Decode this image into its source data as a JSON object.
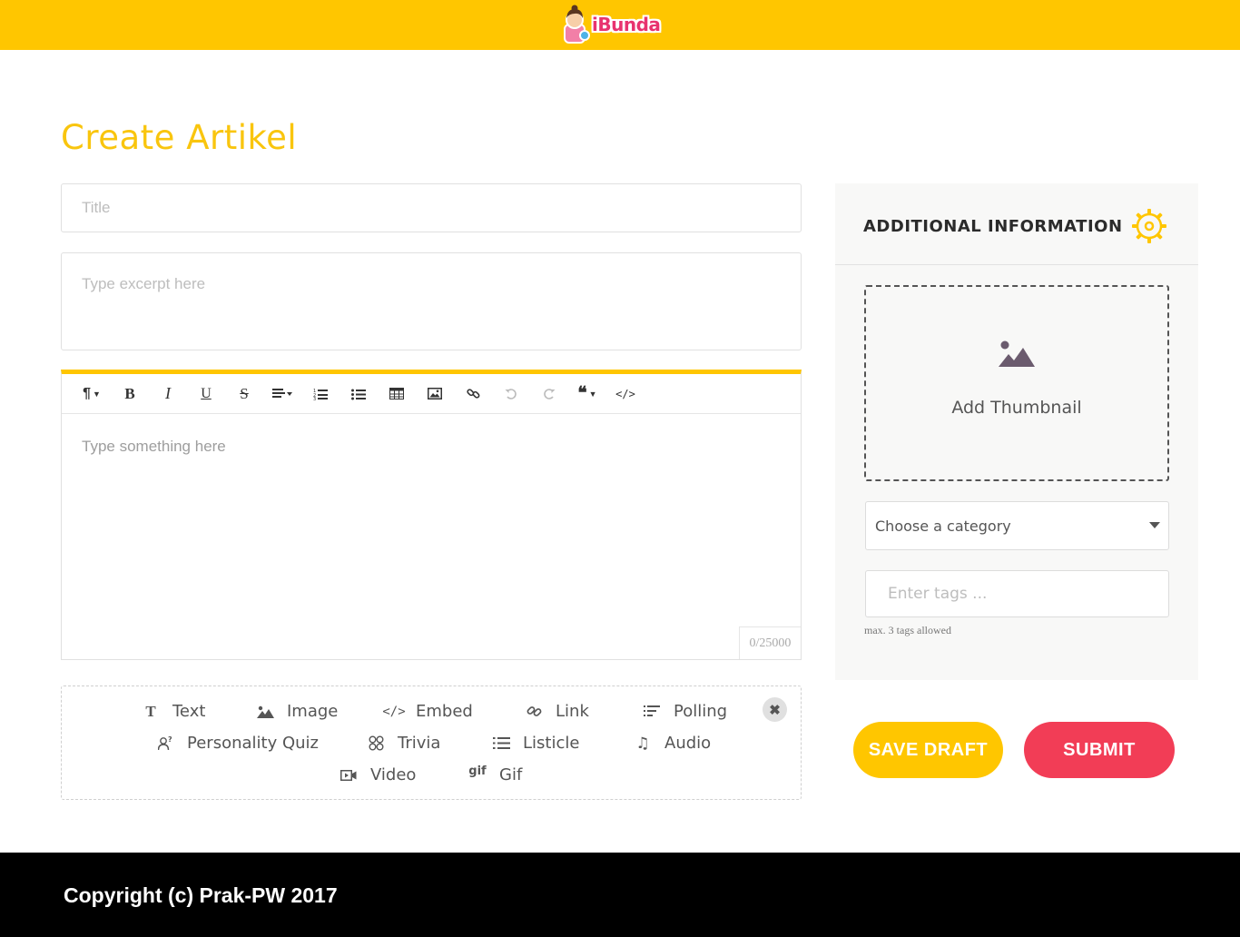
{
  "header": {
    "logo_text": "iBunda",
    "background_color": "#ffc600",
    "logo_color": "#e8336f"
  },
  "page": {
    "title": "Create Artikel",
    "title_color": "#f9c50e"
  },
  "form": {
    "title_placeholder": "Title",
    "excerpt_placeholder": "Type excerpt here",
    "editor_placeholder": "Type something here",
    "char_counter": "0/25000"
  },
  "toolbar": {
    "items": [
      {
        "name": "paragraph-format-icon",
        "glyph": "¶▾"
      },
      {
        "name": "bold-icon",
        "glyph": "B"
      },
      {
        "name": "italic-icon",
        "glyph": "I"
      },
      {
        "name": "underline-icon",
        "glyph": "U"
      },
      {
        "name": "strikethrough-icon",
        "glyph": "S"
      },
      {
        "name": "align-icon",
        "glyph": "align"
      },
      {
        "name": "ordered-list-icon",
        "glyph": "ol"
      },
      {
        "name": "unordered-list-icon",
        "glyph": "ul"
      },
      {
        "name": "table-icon",
        "glyph": "table"
      },
      {
        "name": "insert-image-icon",
        "glyph": "image"
      },
      {
        "name": "link-icon",
        "glyph": "link"
      },
      {
        "name": "undo-icon",
        "glyph": "undo"
      },
      {
        "name": "redo-icon",
        "glyph": "redo"
      },
      {
        "name": "quote-icon",
        "glyph": "quote"
      },
      {
        "name": "code-view-icon",
        "glyph": "code"
      }
    ]
  },
  "blocks": {
    "text": "Text",
    "image": "Image",
    "embed": "Embed",
    "link": "Link",
    "polling": "Polling",
    "personality_quiz": "Personality Quiz",
    "trivia": "Trivia",
    "listicle": "Listicle",
    "audio": "Audio",
    "video": "Video",
    "gif": "Gif",
    "gif_icon_text": "gif",
    "close_glyph": "✖"
  },
  "sidebar": {
    "title": "ADDITIONAL INFORMATION",
    "thumbnail_label": "Add Thumbnail",
    "category_placeholder": "Choose a category",
    "tags_placeholder": "Enter tags ...",
    "tags_note": "max. 3 tags allowed",
    "accent_color": "#ffc600"
  },
  "actions": {
    "save_draft": "SAVE DRAFT",
    "submit": "SUBMIT",
    "save_color": "#ffc600",
    "submit_color": "#f23d56"
  },
  "footer": {
    "copyright": "Copyright (c) Prak-PW 2017"
  }
}
